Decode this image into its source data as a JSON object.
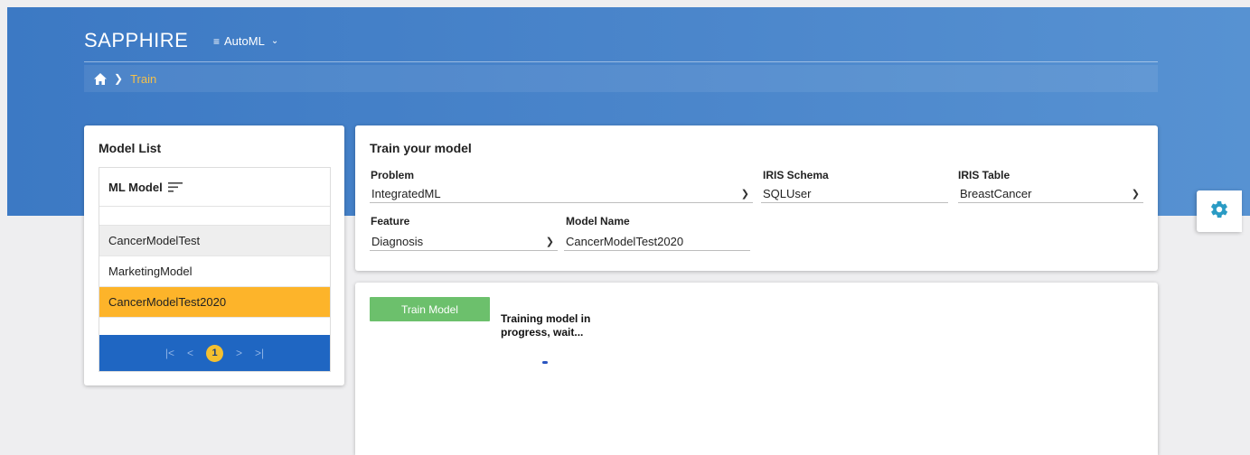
{
  "header": {
    "brand": "SAPPHIRE",
    "menu_label": "AutoML"
  },
  "breadcrumb": {
    "current": "Train"
  },
  "model_list": {
    "title": "Model List",
    "column_header": "ML Model",
    "rows": [
      "CancerModelTest",
      "MarketingModel",
      "CancerModelTest2020"
    ],
    "selected_row": "CancerModelTest2020",
    "pager": {
      "first": "|<",
      "prev": "<",
      "current_page": "1",
      "next": ">",
      "last": ">|"
    }
  },
  "train_form": {
    "title": "Train your model",
    "problem_label": "Problem",
    "problem_value": "IntegratedML",
    "schema_label": "IRIS Schema",
    "schema_value": "SQLUser",
    "table_label": "IRIS Table",
    "table_value": "BreastCancer",
    "feature_label": "Feature",
    "feature_value": "Diagnosis",
    "model_name_label": "Model Name",
    "model_name_value": "CancerModelTest2020"
  },
  "result": {
    "train_button": "Train Model",
    "status_text": "Training model in progress, wait..."
  },
  "icons": {
    "home": "home-icon",
    "settings": "gear-icon",
    "menu": "hamburger-icon",
    "sort": "sort-icon"
  },
  "colors": {
    "banner": "#4a86cb",
    "selected_row": "#fdb42a",
    "pager_bg": "#1f66c2",
    "train_button": "#6cc06c",
    "gear": "#2a9bc4",
    "breadcrumb_active": "#f4c04b"
  }
}
